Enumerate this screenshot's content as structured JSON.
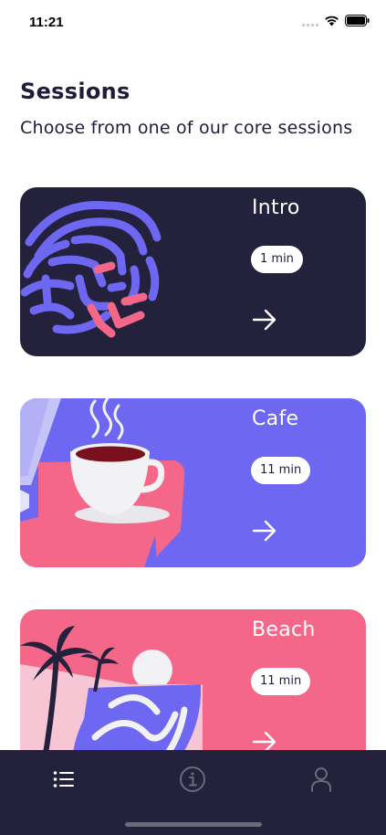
{
  "status_bar": {
    "time": "11:21"
  },
  "header": {
    "title": "Sessions",
    "subtitle": "Choose from one of our core sessions"
  },
  "sessions": [
    {
      "title": "Intro",
      "duration": "1 min",
      "color": "#23213b",
      "art_icon": "brain-illustration"
    },
    {
      "title": "Cafe",
      "duration": "11 min",
      "color": "#6d67f2",
      "art_icon": "coffee-cup-illustration"
    },
    {
      "title": "Beach",
      "duration": "11 min",
      "color": "#f46789",
      "art_icon": "beach-illustration"
    }
  ],
  "tab_bar": {
    "tabs": [
      {
        "icon": "list-icon",
        "active": true
      },
      {
        "icon": "info-icon",
        "active": false
      },
      {
        "icon": "profile-icon",
        "active": false
      }
    ]
  },
  "colors": {
    "accent_purple": "#6d67f2",
    "accent_pink": "#f46789",
    "dark": "#23213b"
  }
}
